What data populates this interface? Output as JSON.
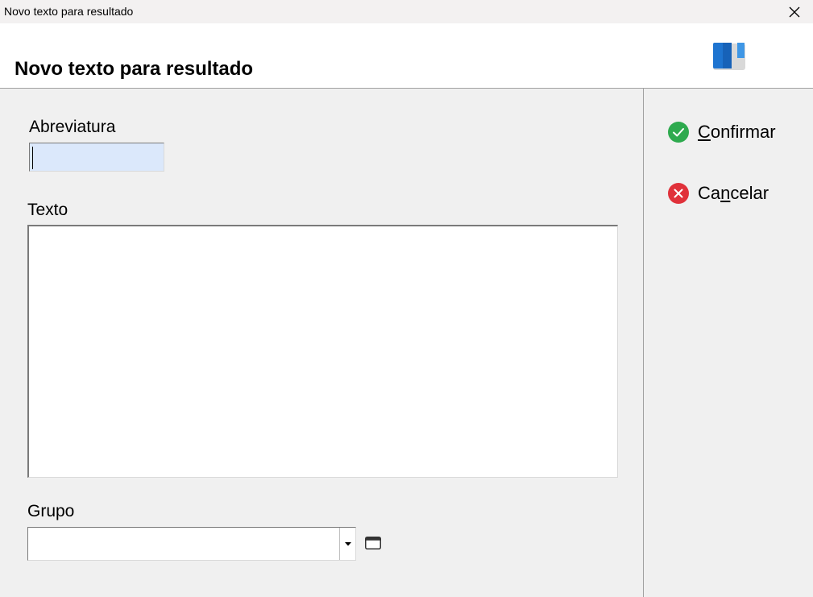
{
  "window": {
    "title": "Novo texto para resultado"
  },
  "header": {
    "heading": "Novo texto para resultado",
    "logo_icon": "book-icon"
  },
  "form": {
    "abbreviation": {
      "label": "Abreviatura",
      "value": ""
    },
    "text": {
      "label": "Texto",
      "value": ""
    },
    "group": {
      "label": "Grupo",
      "value": ""
    }
  },
  "actions": {
    "confirm": {
      "mnemonic": "C",
      "rest": "onfirmar",
      "icon": "check-circle-icon",
      "color": "#2eaa4e"
    },
    "cancel": {
      "pre": "Ca",
      "mnemonic": "n",
      "rest": "celar",
      "icon": "x-circle-icon",
      "color": "#e0313a"
    }
  }
}
